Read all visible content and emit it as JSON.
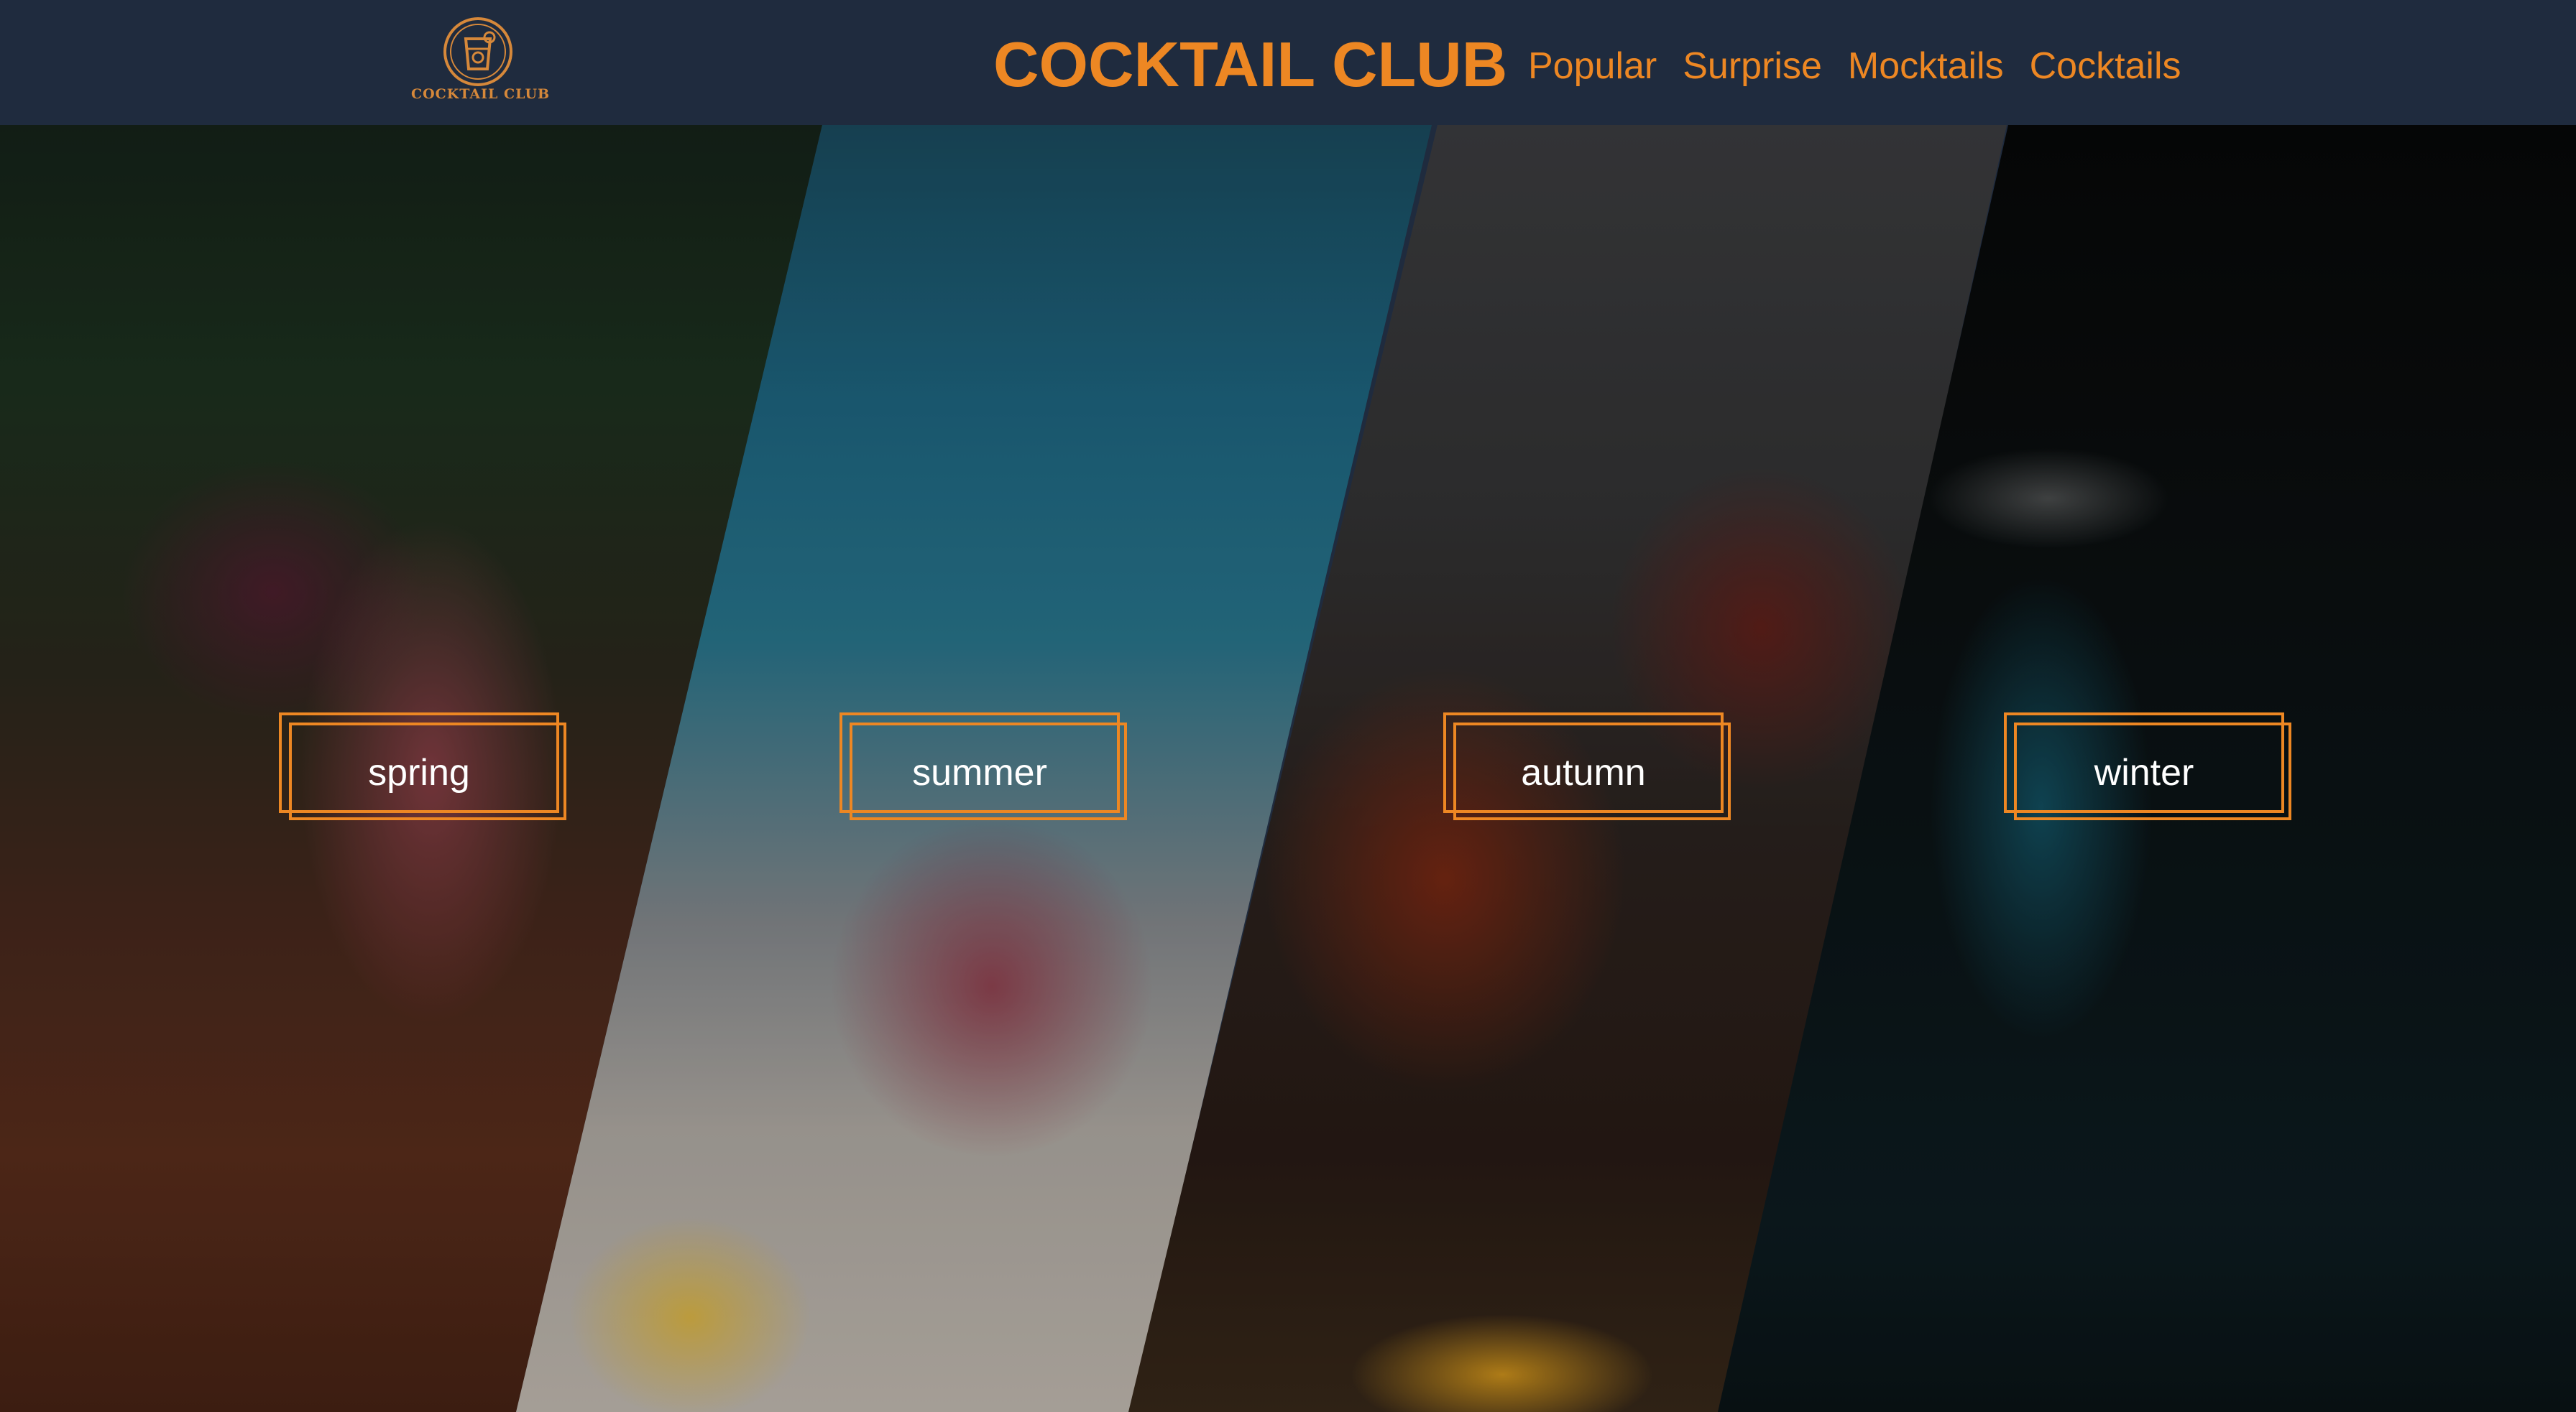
{
  "header": {
    "logo_text": "COCKTAIL CLUB",
    "logo_icon": "cocktail-glass-icon",
    "title": "COCKTAIL CLUB",
    "nav": [
      {
        "label": "Popular"
      },
      {
        "label": "Surprise"
      },
      {
        "label": "Mocktails"
      },
      {
        "label": "Cocktails"
      }
    ]
  },
  "seasons": [
    {
      "label": "spring"
    },
    {
      "label": "summer"
    },
    {
      "label": "autumn"
    },
    {
      "label": "winter"
    }
  ],
  "colors": {
    "header_bg": "#1f2b3e",
    "accent": "#ed8723",
    "button_text": "#ffffff"
  }
}
